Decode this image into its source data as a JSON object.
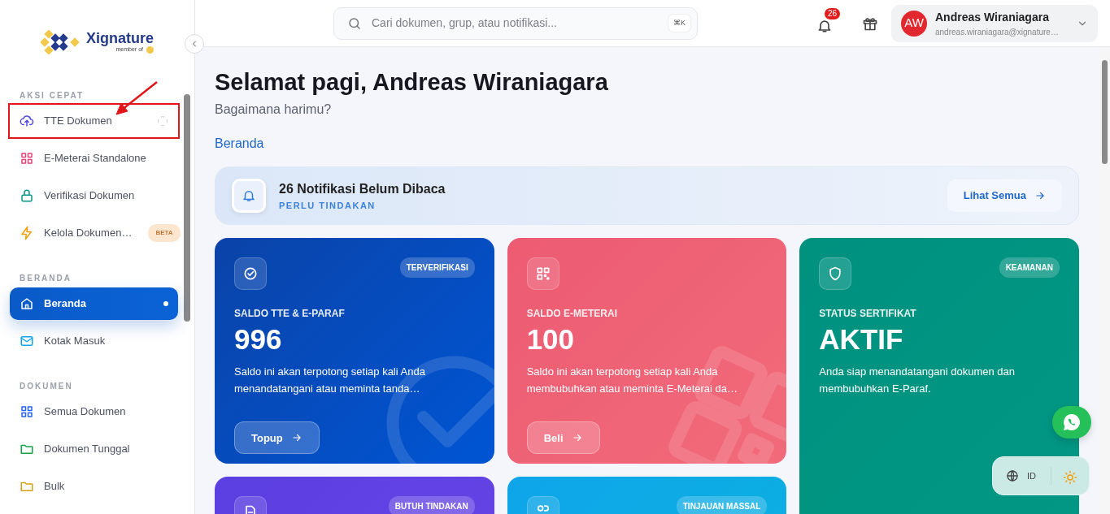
{
  "sidebar": {
    "logo": {
      "name": "Xignature",
      "tagline": "member of"
    },
    "sections": [
      {
        "heading": "AKSI CEPAT",
        "items": [
          {
            "kind": "upload",
            "label": "TTE Dokumen",
            "color": "#4f46e5",
            "selected": false,
            "highlighted": true
          },
          {
            "kind": "grid",
            "label": "E-Meterai Standalone",
            "color": "#e0457b",
            "selected": false,
            "highlighted": false
          },
          {
            "kind": "lock",
            "label": "Verifikasi Dokumen",
            "color": "#0d9488",
            "selected": false,
            "highlighted": false
          },
          {
            "kind": "bolt",
            "label": "Kelola Dokumen…",
            "color": "#f59e0b",
            "selected": false,
            "highlighted": false,
            "badge": "BETA"
          }
        ]
      },
      {
        "heading": "BERANDA",
        "items": [
          {
            "kind": "home",
            "label": "Beranda",
            "selected": true,
            "highlighted": false
          },
          {
            "kind": "mail",
            "label": "Kotak Masuk",
            "color": "#0ea5e9",
            "selected": false,
            "highlighted": false
          }
        ]
      },
      {
        "heading": "DOKUMEN",
        "items": [
          {
            "kind": "grid",
            "label": "Semua Dokumen",
            "color": "#2563eb",
            "selected": false,
            "highlighted": false
          },
          {
            "kind": "folder",
            "label": "Dokumen Tunggal",
            "color": "#16a34a",
            "selected": false,
            "highlighted": false
          },
          {
            "kind": "folder",
            "label": "Bulk",
            "color": "#d4a017",
            "selected": false,
            "highlighted": false
          }
        ]
      }
    ]
  },
  "header": {
    "search": {
      "placeholder": "Cari dokumen, grup, atau notifikasi...",
      "shortcut": "⌘K"
    },
    "notification_count": "26",
    "user": {
      "initials": "AW",
      "name": "Andreas Wiraniagara",
      "email": "andreas.wiraniagara@xignature…"
    }
  },
  "greeting": {
    "title": "Selamat pagi, Andreas Wiraniagara",
    "subtitle": "Bagaimana harimu?"
  },
  "breadcrumb": "Beranda",
  "notification_banner": {
    "title": "26 Notifikasi Belum Dibaca",
    "subtitle": "PERLU TINDAKAN",
    "button": "Lihat Semua"
  },
  "cards": [
    {
      "kind": "tte",
      "tag": "TERVERIFIKASI",
      "label": "SALDO TTE & E-PARAF",
      "value": "996",
      "description": "Saldo ini akan terpotong setiap kali Anda menandatangani atau meminta tanda…",
      "button": "Topup"
    },
    {
      "kind": "meterai",
      "label": "SALDO E-METERAI",
      "value": "100",
      "description": "Saldo ini akan terpotong setiap kali Anda membubuhkan atau meminta E-Meterai da…",
      "button": "Beli"
    },
    {
      "kind": "cert",
      "tag": "KEAMANAN",
      "label": "STATUS SERTIFIKAT",
      "value": "AKTIF",
      "description": "Anda siap menandatangani dokumen dan membubuhkan E-Paraf."
    },
    {
      "kind": "doc",
      "tag": "BUTUH TINDAKAN"
    },
    {
      "kind": "review",
      "tag": "TINJAUAN MASSAL"
    }
  ],
  "widget": {
    "language": "ID"
  }
}
